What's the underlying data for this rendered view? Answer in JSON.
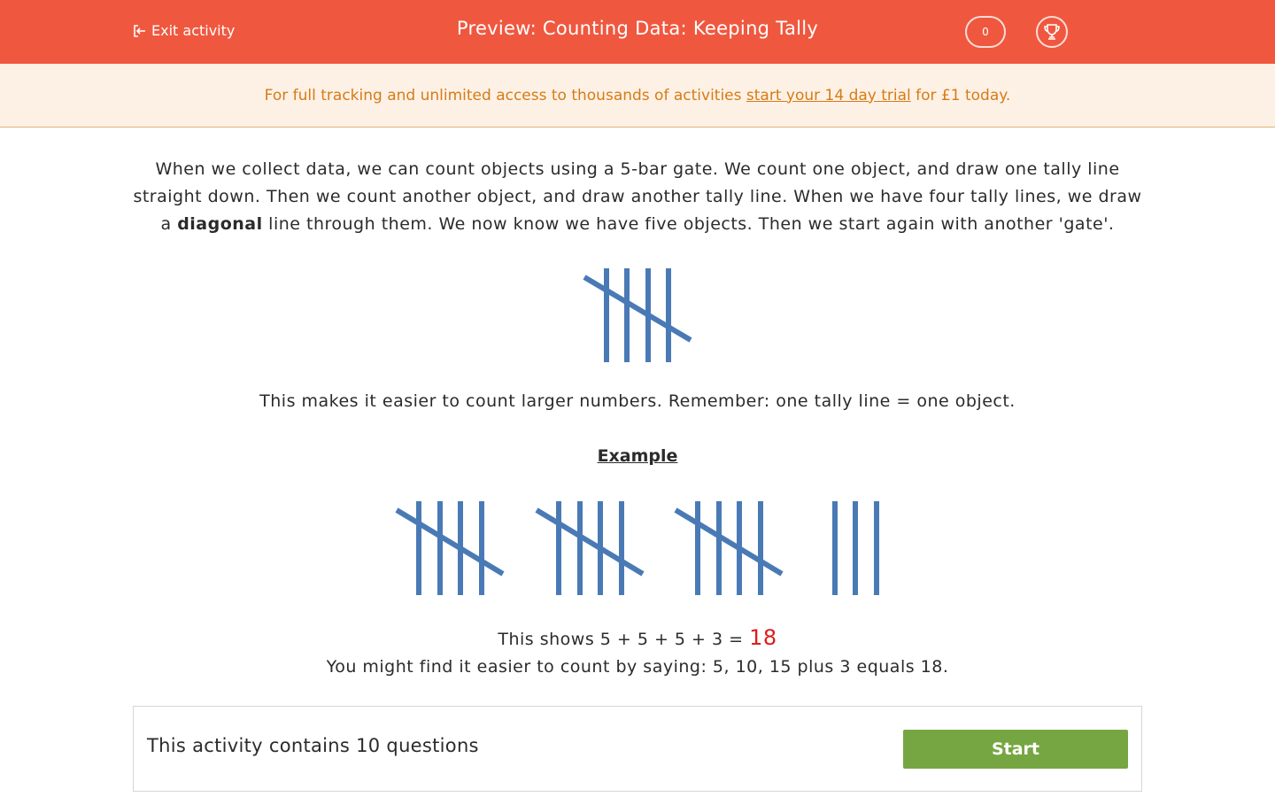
{
  "header": {
    "exit_label": "Exit activity",
    "title": "Preview: Counting Data: Keeping Tally",
    "score": "0",
    "icons": {
      "exit": "exit-arrow-icon",
      "trophy": "trophy-icon"
    }
  },
  "promo": {
    "before": "For full tracking and unlimited access to thousands of activities ",
    "link": "start your 14 day trial",
    "after": " for £1 today."
  },
  "intro": {
    "part1": "When we collect data, we can count objects using a 5-bar gate. We count one object, and draw one tally line straight down. Then we count another object, and draw another tally line. When we have four tally lines, we draw a ",
    "bold": "diagonal",
    "part2": " line through them. We now know we have five objects. Then we start again with another 'gate'."
  },
  "diagram_tally": {
    "count": 5
  },
  "remember": "This makes it easier to count larger numbers. Remember: one tally line = one object.",
  "example": {
    "heading": "Example",
    "tally_groups": [
      5,
      5,
      5,
      3
    ],
    "shows_text": "This shows 5 + 5 + 5 + 3 = ",
    "answer": "18",
    "tip": "You might find it easier to count by saying: 5, 10, 15 plus 3 equals 18."
  },
  "activity": {
    "text": "This activity contains 10 questions",
    "start_label": "Start"
  },
  "colors": {
    "header_bg": "#ef583f",
    "promo_bg": "#fdf1e6",
    "promo_text": "#d77b14",
    "tally": "#4a7ab5",
    "answer": "#e01b1b",
    "start_bg": "#76a642"
  }
}
